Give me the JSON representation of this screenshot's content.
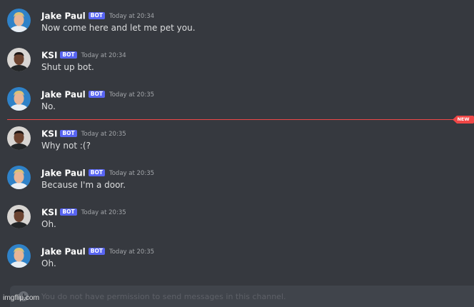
{
  "colors": {
    "background": "#36393f",
    "bot_tag": "#5865f2",
    "new_divider": "#f04747",
    "username": "#ffffff",
    "message_text": "#dcddde",
    "timestamp": "#a3a6aa"
  },
  "messages": [
    {
      "author": "Jake Paul",
      "bot_tag": "BOT",
      "timestamp": "Today at 20:34",
      "content": "Now come here and let me pet you.",
      "avatar": "jake-paul-avatar"
    },
    {
      "author": "KSI",
      "bot_tag": "BOT",
      "timestamp": "Today at 20:34",
      "content": "Shut up bot.",
      "avatar": "ksi-avatar"
    },
    {
      "author": "Jake Paul",
      "bot_tag": "BOT",
      "timestamp": "Today at 20:35",
      "content": "No.",
      "avatar": "jake-paul-avatar"
    },
    {
      "author": "KSI",
      "bot_tag": "BOT",
      "timestamp": "Today at 20:35",
      "content": "Why not :(?",
      "avatar": "ksi-avatar"
    },
    {
      "author": "Jake Paul",
      "bot_tag": "BOT",
      "timestamp": "Today at 20:35",
      "content": "Because I'm a door.",
      "avatar": "jake-paul-avatar"
    },
    {
      "author": "KSI",
      "bot_tag": "BOT",
      "timestamp": "Today at 20:35",
      "content": "Oh.",
      "avatar": "ksi-avatar"
    },
    {
      "author": "Jake Paul",
      "bot_tag": "BOT",
      "timestamp": "Today at 20:35",
      "content": "Oh.",
      "avatar": "jake-paul-avatar"
    }
  ],
  "new_divider": {
    "label": "NEW"
  },
  "input": {
    "placeholder": "You do not have permission to send messages in this channel.",
    "attach_icon": "plus-circle-icon"
  },
  "watermark": "imgflip.com"
}
